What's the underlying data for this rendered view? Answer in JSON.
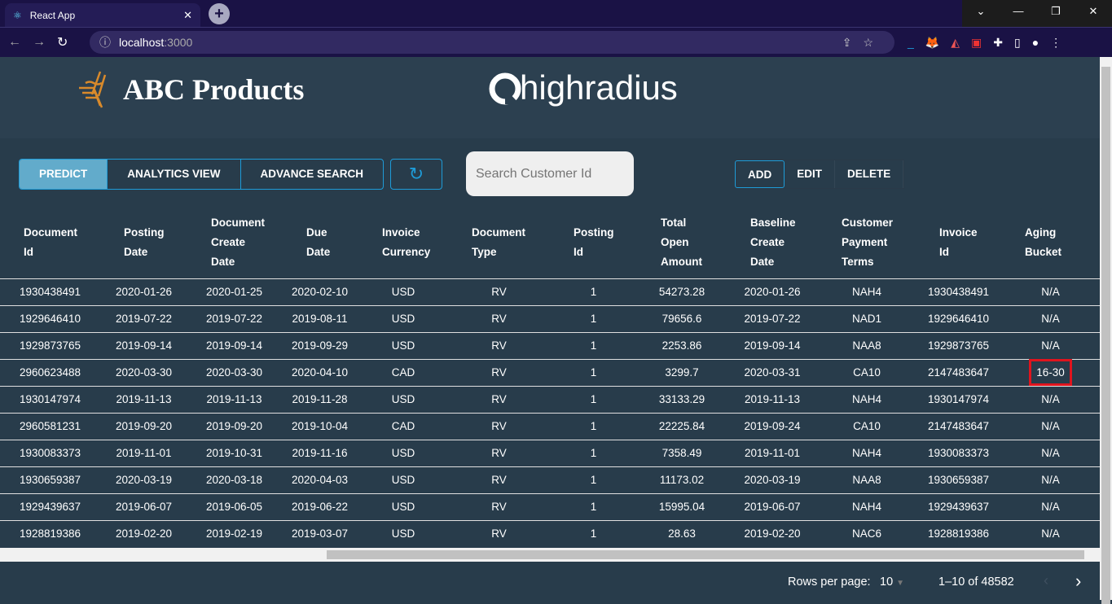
{
  "browser": {
    "tab_title": "React App",
    "url_host": "localhost",
    "url_port": ":3000"
  },
  "header": {
    "brand": "ABC Products",
    "partner_logo": "highradius"
  },
  "toolbar": {
    "predict": "PREDICT",
    "analytics": "ANALYTICS VIEW",
    "advance_search": "ADVANCE SEARCH",
    "search_placeholder": "Search Customer Id",
    "add": "ADD",
    "edit": "EDIT",
    "delete": "DELETE"
  },
  "table": {
    "columns": [
      [
        "Document",
        "Id"
      ],
      [
        "Posting",
        "Date"
      ],
      [
        "Document",
        "Create",
        "Date"
      ],
      [
        "Due",
        "Date"
      ],
      [
        "Invoice",
        "Currency"
      ],
      [
        "Document",
        "Type"
      ],
      [
        "Posting",
        "Id"
      ],
      [
        "Total",
        "Open",
        "Amount"
      ],
      [
        "Baseline",
        "Create",
        "Date"
      ],
      [
        "Customer",
        "Payment",
        "Terms"
      ],
      [
        "Invoice",
        "Id"
      ],
      [
        "Aging",
        "Bucket"
      ]
    ],
    "rows": [
      [
        "1930438491",
        "2020-01-26",
        "2020-01-25",
        "2020-02-10",
        "USD",
        "RV",
        "1",
        "54273.28",
        "2020-01-26",
        "NAH4",
        "1930438491",
        "N/A"
      ],
      [
        "1929646410",
        "2019-07-22",
        "2019-07-22",
        "2019-08-11",
        "USD",
        "RV",
        "1",
        "79656.6",
        "2019-07-22",
        "NAD1",
        "1929646410",
        "N/A"
      ],
      [
        "1929873765",
        "2019-09-14",
        "2019-09-14",
        "2019-09-29",
        "USD",
        "RV",
        "1",
        "2253.86",
        "2019-09-14",
        "NAA8",
        "1929873765",
        "N/A"
      ],
      [
        "2960623488",
        "2020-03-30",
        "2020-03-30",
        "2020-04-10",
        "CAD",
        "RV",
        "1",
        "3299.7",
        "2020-03-31",
        "CA10",
        "2147483647",
        "16-30"
      ],
      [
        "1930147974",
        "2019-11-13",
        "2019-11-13",
        "2019-11-28",
        "USD",
        "RV",
        "1",
        "33133.29",
        "2019-11-13",
        "NAH4",
        "1930147974",
        "N/A"
      ],
      [
        "2960581231",
        "2019-09-20",
        "2019-09-20",
        "2019-10-04",
        "CAD",
        "RV",
        "1",
        "22225.84",
        "2019-09-24",
        "CA10",
        "2147483647",
        "N/A"
      ],
      [
        "1930083373",
        "2019-11-01",
        "2019-10-31",
        "2019-11-16",
        "USD",
        "RV",
        "1",
        "7358.49",
        "2019-11-01",
        "NAH4",
        "1930083373",
        "N/A"
      ],
      [
        "1930659387",
        "2020-03-19",
        "2020-03-18",
        "2020-04-03",
        "USD",
        "RV",
        "1",
        "11173.02",
        "2020-03-19",
        "NAA8",
        "1930659387",
        "N/A"
      ],
      [
        "1929439637",
        "2019-06-07",
        "2019-06-05",
        "2019-06-22",
        "USD",
        "RV",
        "1",
        "15995.04",
        "2019-06-07",
        "NAH4",
        "1929439637",
        "N/A"
      ],
      [
        "1928819386",
        "2019-02-20",
        "2019-02-19",
        "2019-03-07",
        "USD",
        "RV",
        "1",
        "28.63",
        "2019-02-20",
        "NAC6",
        "1928819386",
        "N/A"
      ]
    ],
    "highlighted_cell": {
      "row": 3,
      "col": 11,
      "color": "#e0141e"
    }
  },
  "pager": {
    "rows_label": "Rows per page:",
    "rows_value": "10",
    "range": "1–10 of 48582"
  },
  "colors": {
    "accent": "#1e9bd7",
    "active_button": "#62abcb",
    "logo_orange": "#d98a2b"
  }
}
